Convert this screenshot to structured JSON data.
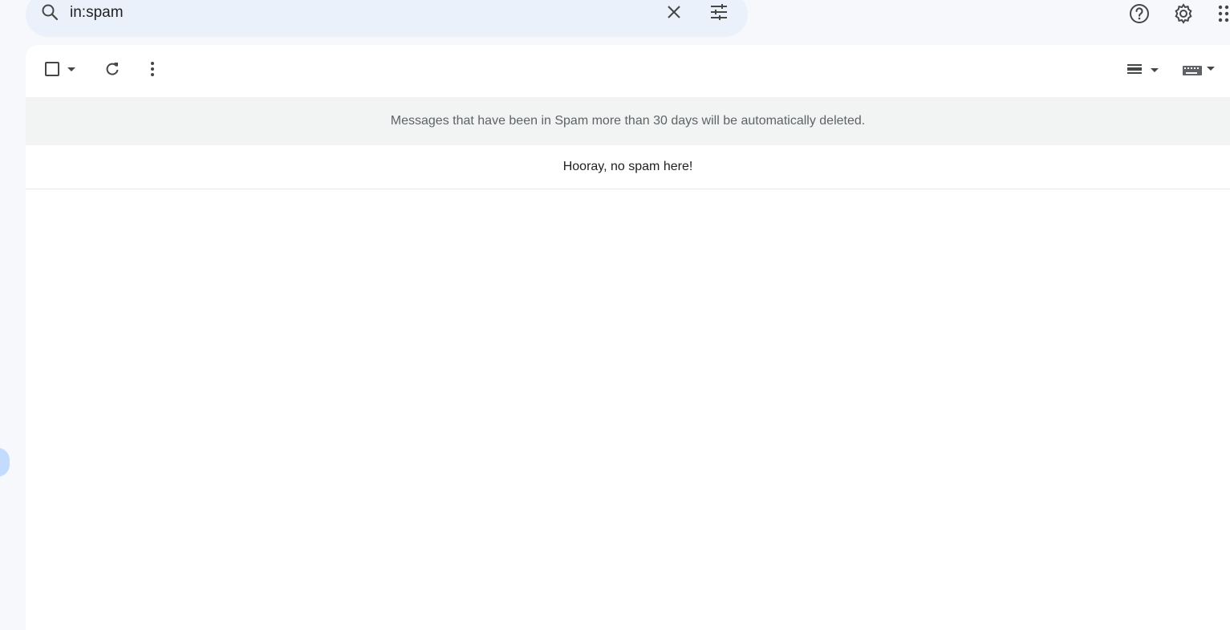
{
  "search": {
    "query": "in:spam",
    "icons": {
      "search": "search-icon",
      "clear": "close-icon",
      "options": "tune-icon"
    }
  },
  "header": {
    "icons": [
      "help-icon",
      "gear-icon",
      "apps-icon"
    ]
  },
  "toolbar": {
    "icons": [
      "checkbox-icon",
      "caret-down-icon",
      "refresh-icon",
      "more-vert-icon",
      "density-icon",
      "keyboard-icon"
    ]
  },
  "notice": {
    "text": "Messages that have been in Spam more than 30 days will be automatically deleted."
  },
  "message_list": {
    "empty_text": "Hooray, no spam here!"
  },
  "colors": {
    "background": "#f6f8fc",
    "search_bg": "#eaf1fb",
    "panel_bg": "#ffffff",
    "notice_bg": "#f2f4f3",
    "icon": "#444746",
    "accent_blob": "#c2dbff"
  }
}
